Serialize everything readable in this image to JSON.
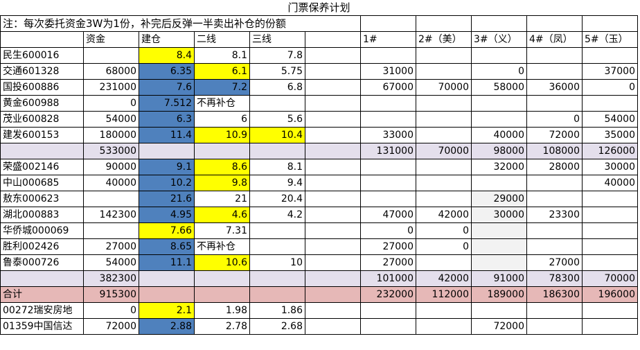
{
  "title": "门票保养计划",
  "note": "注：每次委托资金3W为1份，补完后反弹一半卖出补仓的份额",
  "headers": [
    "",
    "资金",
    "建仓",
    "二线",
    "三线",
    "",
    "1#",
    "2#（美）",
    "3#（义）",
    "4#（凤）",
    "5#（玉）"
  ],
  "rows": [
    [
      "民生600016",
      "",
      "8.4",
      "8.1",
      "7.8",
      "",
      "",
      "",
      "",
      "",
      ""
    ],
    [
      "交通601328",
      "68000",
      "6.35",
      "6.1",
      "5.75",
      "",
      "31000",
      "",
      "0",
      "",
      "37000"
    ],
    [
      "国投600886",
      "231000",
      "7.6",
      "7.2",
      "6.8",
      "",
      "67000",
      "70000",
      "58000",
      "36000",
      "0"
    ],
    [
      "黄金600988",
      "0",
      "7.512",
      "不再补仓",
      "",
      "",
      "",
      "",
      "",
      "",
      ""
    ],
    [
      "茂业600828",
      "54000",
      "6.3",
      "6",
      "5.6",
      "",
      "",
      "",
      "",
      "0",
      "54000"
    ],
    [
      "建发600153",
      "180000",
      "11.4",
      "10.9",
      "10.4",
      "",
      "33000",
      "",
      "40000",
      "72000",
      "35000"
    ],
    [
      "",
      "533000",
      "",
      "",
      "",
      "",
      "131000",
      "70000",
      "98000",
      "108000",
      "126000"
    ],
    [
      "荣盛002146",
      "90000",
      "9.1",
      "8.6",
      "8.1",
      "",
      "",
      "",
      "32000",
      "28000",
      "30000"
    ],
    [
      "中山000685",
      "40000",
      "10.2",
      "9.8",
      "9.4",
      "",
      "",
      "",
      "",
      "",
      "40000"
    ],
    [
      "敖东000623",
      "",
      "21.6",
      "21",
      "20.4",
      "",
      "",
      "",
      "29000",
      "",
      ""
    ],
    [
      "湖北000883",
      "142300",
      "4.95",
      "4.6",
      "4.2",
      "",
      "47000",
      "42000",
      "30000",
      "23300",
      ""
    ],
    [
      "华侨城000069",
      "",
      "7.66",
      "7.31",
      "",
      "",
      "0",
      "0",
      "",
      "",
      ""
    ],
    [
      "胜利002426",
      "27000",
      "8.65",
      "不再补仓",
      "",
      "",
      "27000",
      "0",
      "",
      "",
      ""
    ],
    [
      "鲁泰000726",
      "54000",
      "11.1",
      "10.6",
      "10",
      "",
      "27000",
      "",
      "",
      "27000",
      ""
    ],
    [
      "",
      "382300",
      "",
      "",
      "",
      "",
      "101000",
      "42000",
      "91000",
      "78300",
      "70000"
    ],
    [
      "合计",
      "915300",
      "",
      "",
      "",
      "",
      "232000",
      "112000",
      "189000",
      "186300",
      "196000"
    ],
    [
      "00272瑞安房地",
      "0",
      "2.1",
      "1.98",
      "1.86",
      "",
      "",
      "",
      "",
      "",
      ""
    ],
    [
      "01359中国信达",
      "72000",
      "2.88",
      "2.78",
      "2.68",
      "",
      "",
      "",
      "72000",
      "",
      ""
    ]
  ],
  "colors": {
    "blue": "#4f81bd",
    "yellow": "#ffff00",
    "subtotal": "#e4dfec",
    "total": "#e6b8b7",
    "empty_shade": "#f2f2f2"
  }
}
